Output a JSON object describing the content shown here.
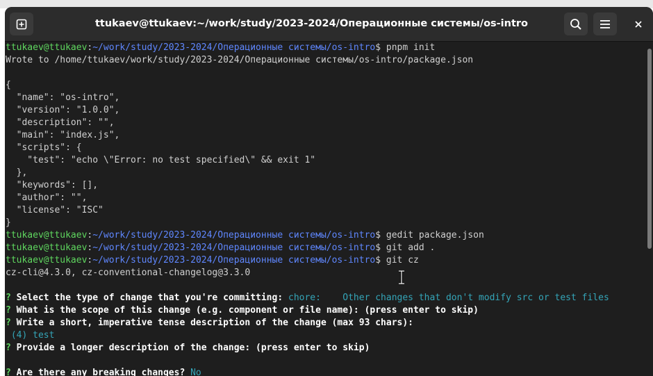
{
  "window": {
    "title": "ttukaev@ttukaev:~/work/study/2023-2024/Операционные системы/os-intro"
  },
  "prompt": {
    "user": "ttukaev@ttukaev",
    "sep": ":",
    "path": "~/work/study/2023-2024/Операционные системы/os-intro",
    "symbol": "$ "
  },
  "colors": {
    "prompt_user": "#5fd75f",
    "prompt_path": "#5f87ff",
    "answer": "#34a5b8",
    "question": "#ffffff"
  },
  "terminal": {
    "cmd1": "pnpm init",
    "wrote": "Wrote to /home/ttukaev/work/study/2023-2024/Операционные системы/os-intro/package.json",
    "json_lines": [
      "{",
      "  \"name\": \"os-intro\",",
      "  \"version\": \"1.0.0\",",
      "  \"description\": \"\",",
      "  \"main\": \"index.js\",",
      "  \"scripts\": {",
      "    \"test\": \"echo \\\"Error: no test specified\\\" && exit 1\"",
      "  },",
      "  \"keywords\": [],",
      "  \"author\": \"\",",
      "  \"license\": \"ISC\"",
      "}"
    ],
    "cmd2": "gedit package.json",
    "cmd3": "git add .",
    "cmd4": "git cz",
    "cz_version": "cz-cli@4.3.0, cz-conventional-changelog@3.3.0",
    "q_mark": "? ",
    "q1": "Select the type of change that you're committing: ",
    "a1": "chore:    Other changes that don't modify src or test files",
    "q2": "What is the scope of this change (e.g. component or file name): (press enter to skip)",
    "q3": "Write a short, imperative tense description of the change (max 93 chars):",
    "a3": " (4) test",
    "q4": "Provide a longer description of the change: (press enter to skip)",
    "q5": "Are there any breaking changes? ",
    "a5": "No"
  }
}
